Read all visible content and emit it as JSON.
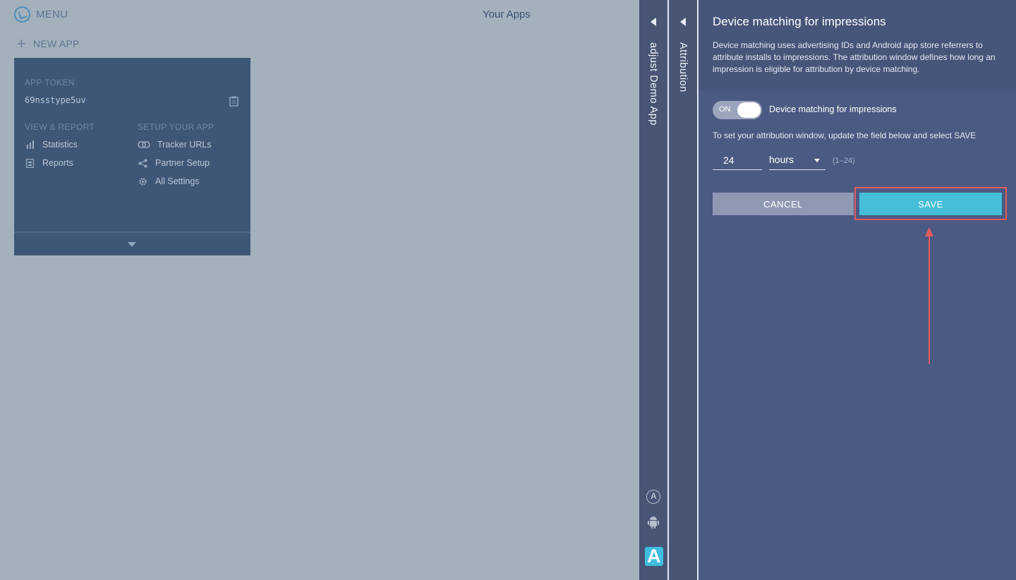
{
  "topbar": {
    "menu_label": "MENU",
    "page_title": "Your Apps"
  },
  "new_app": {
    "label": "NEW APP"
  },
  "app_card": {
    "token_label": "APP TOKEN",
    "token_value": "69nsstype5uv",
    "view_report_label": "VIEW & REPORT",
    "setup_label": "SETUP YOUR APP",
    "view_links": [
      {
        "label": "Statistics",
        "icon": "bar-chart-icon"
      },
      {
        "label": "Reports",
        "icon": "report-icon"
      }
    ],
    "setup_links": [
      {
        "label": "Tracker URLs",
        "icon": "link-icon"
      },
      {
        "label": "Partner Setup",
        "icon": "share-icon"
      },
      {
        "label": "All Settings",
        "icon": "gear-icon"
      }
    ]
  },
  "strips": {
    "app_name": "adjust Demo App",
    "section": "Attribution"
  },
  "panel": {
    "title": "Device matching for impressions",
    "description": "Device matching uses advertising IDs and Android app store referrers to attribute installs to impressions. The attribution window defines how long an impression is eligible for attribution by device matching.",
    "toggle_state": "ON",
    "toggle_label": "Device matching for impressions",
    "instruction": "To set your attribution window, update the field below and select SAVE",
    "window_value": "24",
    "unit": "hours",
    "range_hint": "(1–24)",
    "cancel_label": "CANCEL",
    "save_label": "SAVE"
  },
  "logo_letter": "A",
  "colors": {
    "accent": "#45bed8",
    "highlight": "#e25c60",
    "panel": "#4b5a82"
  }
}
